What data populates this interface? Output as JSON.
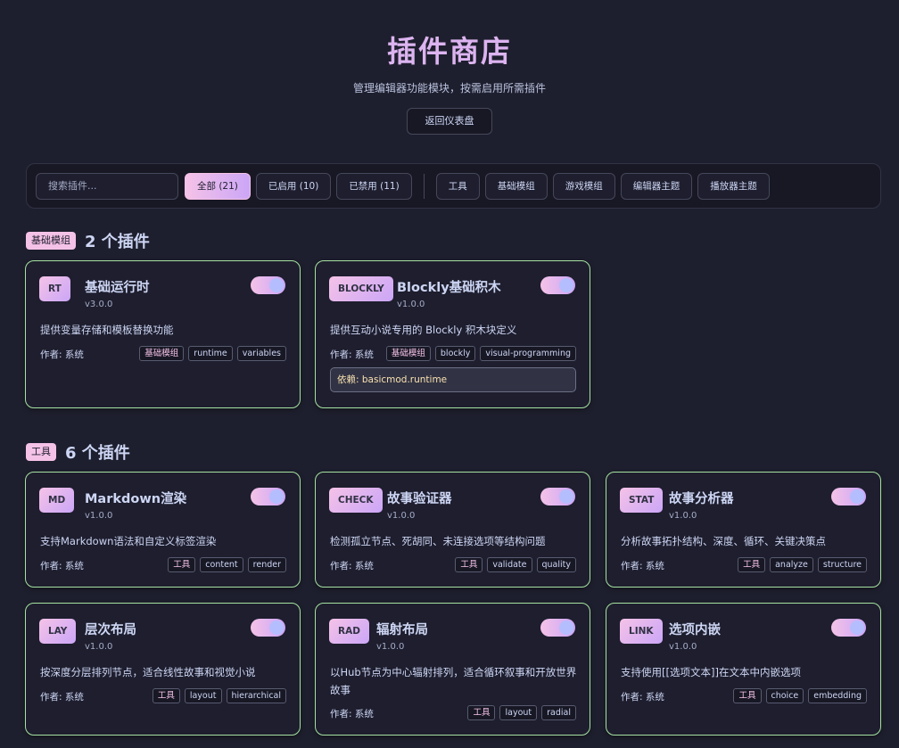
{
  "header": {
    "title": "插件商店",
    "subtitle": "管理编辑器功能模块，按需启用所需插件",
    "back_label": "返回仪表盘"
  },
  "toolbar": {
    "search_placeholder": "搜索插件...",
    "filters": [
      "全部 (21)",
      "已启用 (10)",
      "已禁用 (11)"
    ],
    "categories": [
      "工具",
      "基础模组",
      "游戏模组",
      "编辑器主题",
      "播放器主题"
    ]
  },
  "sections": [
    {
      "badge": "基础模组",
      "count": "2 个插件",
      "cards": [
        {
          "badge": "RT",
          "name": "基础运行时",
          "version": "v3.0.0",
          "desc": "提供变量存储和模板替换功能",
          "author": "作者: 系统",
          "tags": [
            "基础模组",
            "runtime",
            "variables"
          ],
          "enabled": true
        },
        {
          "badge": "BLOCKLY",
          "name": "Blockly基础积木",
          "version": "v1.0.0",
          "desc": "提供互动小说专用的 Blockly 积木块定义",
          "author": "作者: 系统",
          "tags": [
            "基础模组",
            "blockly",
            "visual-programming"
          ],
          "enabled": true,
          "deps": "依赖: basicmod.runtime"
        }
      ]
    },
    {
      "badge": "工具",
      "count": "6 个插件",
      "cards": [
        {
          "badge": "MD",
          "name": "Markdown渲染",
          "version": "v1.0.0",
          "desc": "支持Markdown语法和自定义标签渲染",
          "author": "作者: 系统",
          "tags": [
            "工具",
            "content",
            "render"
          ],
          "enabled": true
        },
        {
          "badge": "CHECK",
          "name": "故事验证器",
          "version": "v1.0.0",
          "desc": "检测孤立节点、死胡同、未连接选项等结构问题",
          "author": "作者: 系统",
          "tags": [
            "工具",
            "validate",
            "quality"
          ],
          "enabled": true
        },
        {
          "badge": "STAT",
          "name": "故事分析器",
          "version": "v1.0.0",
          "desc": "分析故事拓扑结构、深度、循环、关键决策点",
          "author": "作者: 系统",
          "tags": [
            "工具",
            "analyze",
            "structure"
          ],
          "enabled": true
        },
        {
          "badge": "LAY",
          "name": "层次布局",
          "version": "v1.0.0",
          "desc": "按深度分层排列节点，适合线性故事和视觉小说",
          "author": "作者: 系统",
          "tags": [
            "工具",
            "layout",
            "hierarchical"
          ],
          "enabled": true
        },
        {
          "badge": "RAD",
          "name": "辐射布局",
          "version": "v1.0.0",
          "desc": "以Hub节点为中心辐射排列，适合循环叙事和开放世界故事",
          "author": "作者: 系统",
          "tags": [
            "工具",
            "layout",
            "radial"
          ],
          "enabled": true
        },
        {
          "badge": "LINK",
          "name": "选项内嵌",
          "version": "v1.0.0",
          "desc": "支持使用[[选项文本]]在文本中内嵌选项",
          "author": "作者: 系统",
          "tags": [
            "工具",
            "choice",
            "embedding"
          ],
          "enabled": true
        }
      ]
    }
  ],
  "colors": {
    "background": "#1e1f2e",
    "accent_pink": "#f5c2e7",
    "accent_mauve": "#cba6f7",
    "card_border": "#a6e3a1",
    "deps_text": "#f9e2af"
  }
}
